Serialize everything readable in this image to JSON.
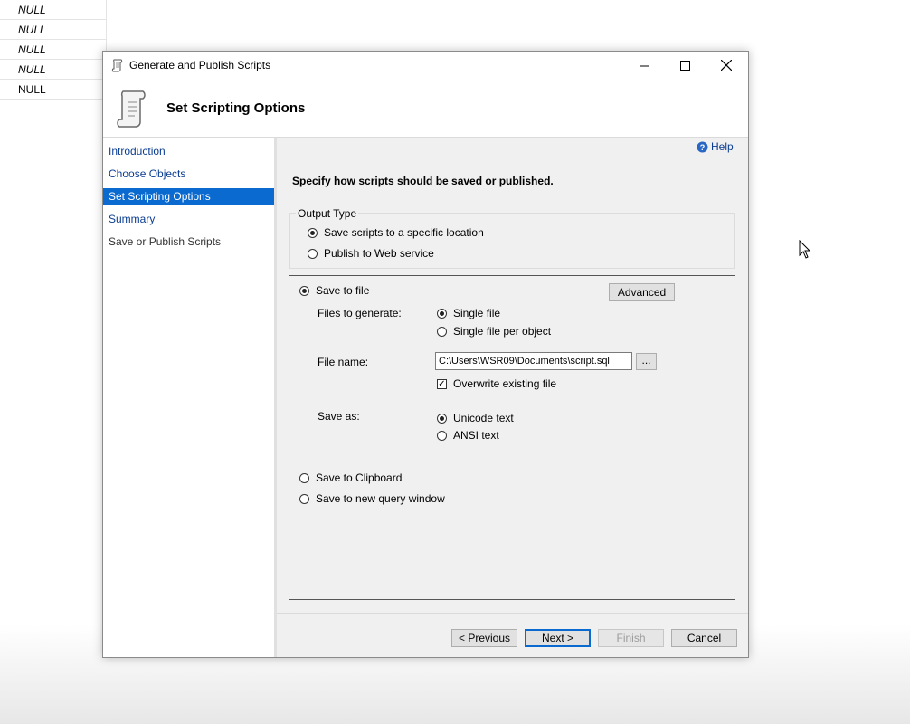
{
  "background": {
    "cells": [
      "NULL",
      "NULL",
      "NULL",
      "NULL",
      "NULL"
    ]
  },
  "dialog": {
    "title": "Generate and Publish Scripts",
    "header_title": "Set Scripting Options",
    "help_label": "Help",
    "description": "Specify how scripts should be saved or published.",
    "nav": [
      {
        "label": "Introduction"
      },
      {
        "label": "Choose Objects"
      },
      {
        "label": "Set Scripting Options",
        "selected": true
      },
      {
        "label": "Summary"
      },
      {
        "label": "Save or Publish Scripts"
      }
    ],
    "output_type": {
      "label": "Output Type",
      "options": [
        "Save scripts to a specific location",
        "Publish to Web service"
      ],
      "selected": "Save scripts to a specific location"
    },
    "save_to_file": {
      "label": "Save to file",
      "advanced_label": "Advanced",
      "files_to_generate_label": "Files to generate:",
      "file_options": [
        "Single file",
        "Single file per object"
      ],
      "file_selected": "Single file",
      "file_name_label": "File name:",
      "file_name_value": "C:\\Users\\WSR09\\Documents\\script.sql",
      "browse_label": "...",
      "overwrite_label": "Overwrite existing file",
      "overwrite_checked": true,
      "save_as_label": "Save as:",
      "save_as_options": [
        "Unicode text",
        "ANSI text"
      ],
      "save_as_selected": "Unicode text"
    },
    "save_to_clipboard_label": "Save to Clipboard",
    "save_to_query_label": "Save to new query window",
    "buttons": {
      "previous": "< Previous",
      "next": "Next >",
      "finish": "Finish",
      "cancel": "Cancel"
    },
    "accent_color": "#0b6acf"
  }
}
